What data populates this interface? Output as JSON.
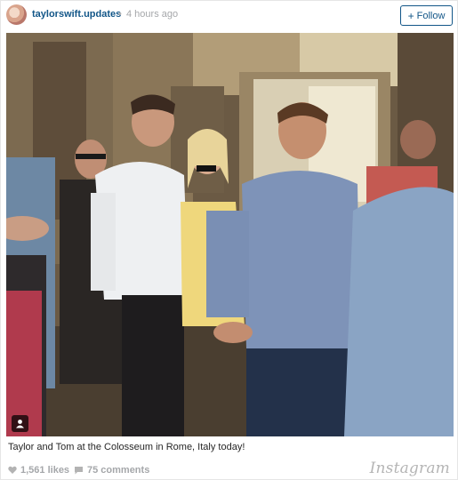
{
  "post": {
    "username": "taylorswift.updates",
    "separator": "•",
    "timestamp": "4 hours ago",
    "follow_label": "Follow",
    "follow_plus": "+",
    "caption": "Taylor and Tom at the Colosseum in Rome, Italy today!",
    "likes": "1,561 likes",
    "comments": "75 comments",
    "brand": "Instagram"
  },
  "colors": {
    "link_blue": "#125688",
    "muted_gray": "#a5a7aa",
    "text_dark": "#262626"
  },
  "icons": {
    "avatar": "profile-avatar",
    "user_tag": "person-tag-icon",
    "likes": "heart-icon",
    "comments": "speech-bubble-icon"
  }
}
